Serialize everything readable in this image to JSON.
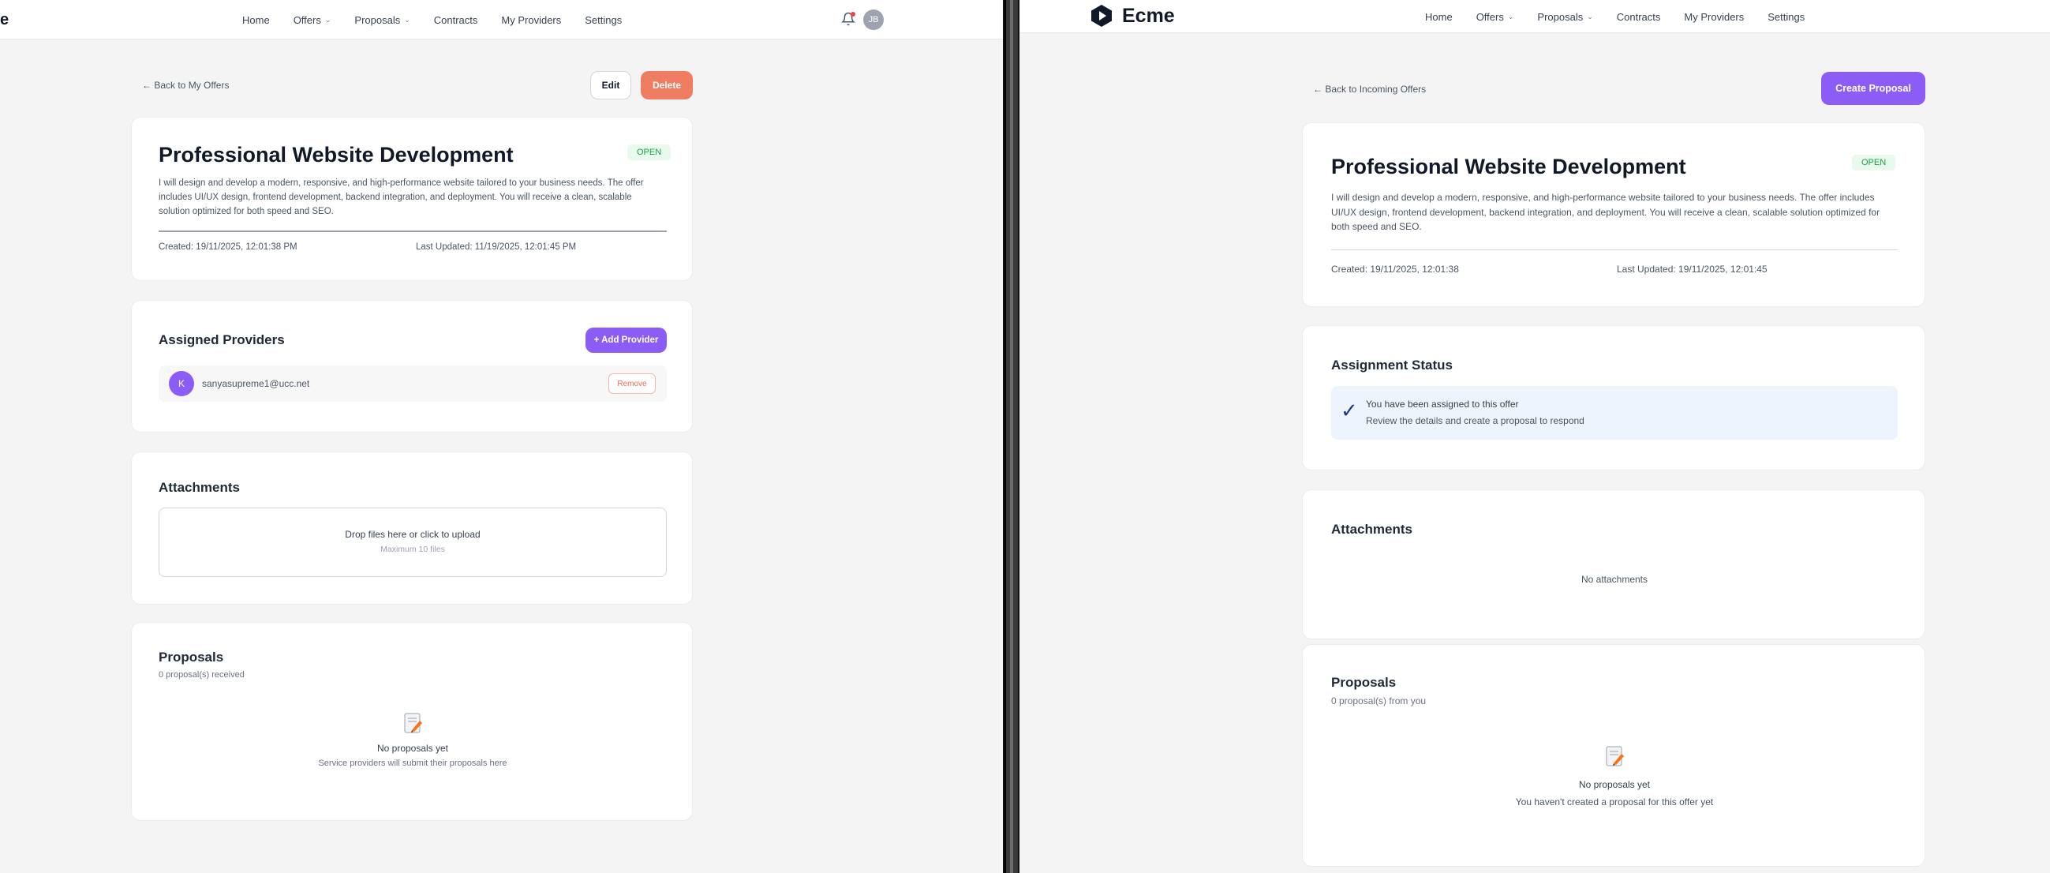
{
  "nav": {
    "home": "Home",
    "offers": "Offers",
    "proposals": "Proposals",
    "contracts": "Contracts",
    "my_providers": "My Providers",
    "settings": "Settings"
  },
  "left": {
    "logo_fragment": "e",
    "avatar_initial": "JB",
    "back_link": "← Back to My Offers",
    "edit_button": "Edit",
    "delete_button": "Delete",
    "offer": {
      "title": "Professional Website Development",
      "status": "OPEN",
      "description": "I will design and develop a modern, responsive, and high-performance website tailored to your business needs. The offer includes UI/UX design, frontend development, backend integration, and deployment. You will receive a clean, scalable solution optimized for both speed and SEO.",
      "created": "Created: 19/11/2025, 12:01:38 PM",
      "updated": "Last Updated: 11/19/2025, 12:01:45 PM"
    },
    "providers": {
      "title": "Assigned Providers",
      "add_button": "+ Add Provider",
      "items": [
        {
          "initial": "K",
          "email": "sanyasupreme1@ucc.net",
          "remove": "Remove"
        }
      ]
    },
    "attachments": {
      "title": "Attachments",
      "drop_text": "Drop files here or click to upload",
      "drop_sub": "Maximum 10 files"
    },
    "proposals": {
      "title": "Proposals",
      "count": "0 proposal(s) received",
      "empty_title": "No proposals yet",
      "empty_sub": "Service providers will submit their proposals here"
    }
  },
  "right": {
    "brand": "Ecme",
    "back_link": "← Back to Incoming Offers",
    "create_button": "Create Proposal",
    "offer": {
      "title": "Professional Website Development",
      "status": "OPEN",
      "description": "I will design and develop a modern, responsive, and high-performance website tailored to your business needs. The offer includes UI/UX design, frontend development, backend integration, and deployment. You will receive a clean, scalable solution optimized for both speed and SEO.",
      "created": "Created: 19/11/2025, 12:01:38",
      "updated": "Last Updated: 19/11/2025, 12:01:45"
    },
    "assignment": {
      "title": "Assignment Status",
      "line1": "You have been assigned to this offer",
      "line2": "Review the details and create a proposal to respond"
    },
    "attachments": {
      "title": "Attachments",
      "empty": "No attachments"
    },
    "proposals": {
      "title": "Proposals",
      "count": "0 proposal(s) from you",
      "empty_title": "No proposals yet",
      "empty_sub": "You haven't created a proposal for this offer yet"
    }
  }
}
